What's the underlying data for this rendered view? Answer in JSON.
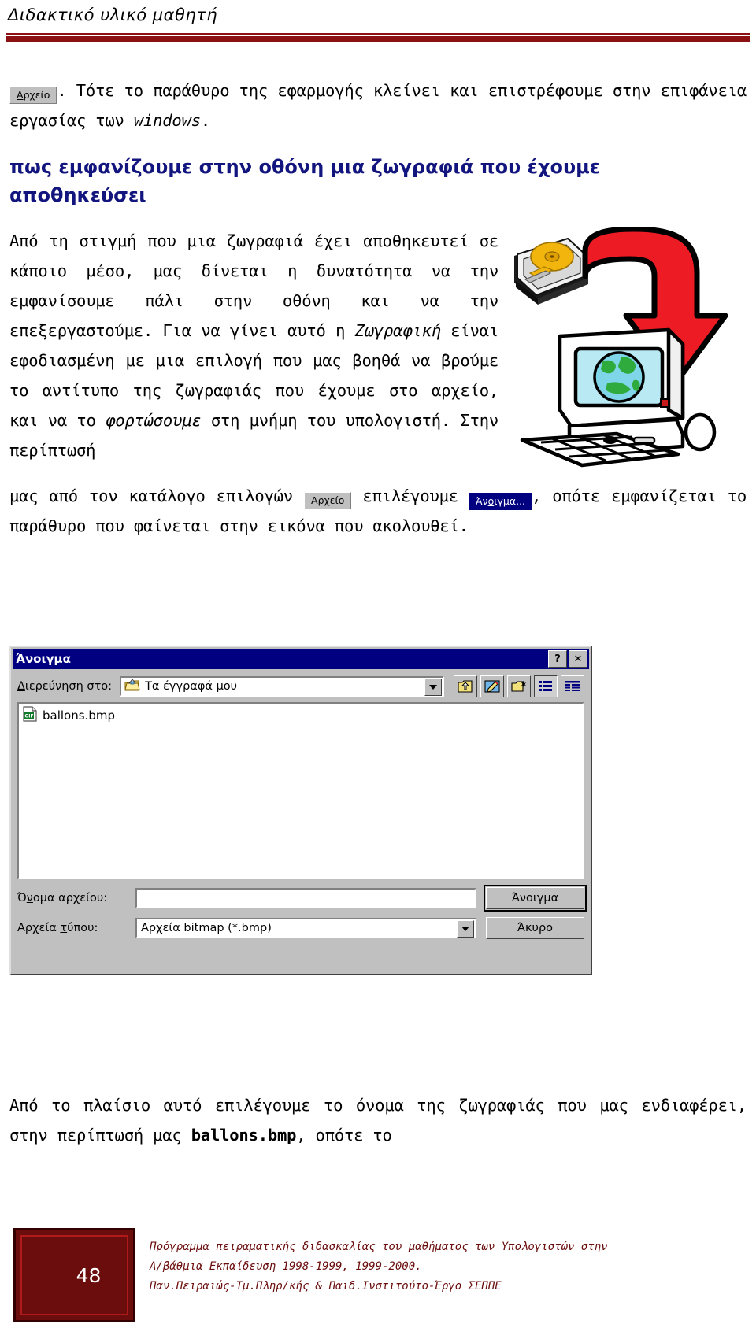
{
  "header": {
    "title": "Διδακτικό υλικό μαθητή",
    "rule_color": "#8b1113"
  },
  "content": {
    "para_intro_after_chip": ". Τότε το παράθυρο της εφαρμογής κλείνει και επιστρέφουμε στην επιφάνεια εργασίας των ",
    "para_intro_italic": "windows",
    "para_intro_end": ".",
    "heading_line1": "πως εμφανίζουμε στην οθόνη μια ζωγραφιά που έχουμε",
    "heading_line2": "αποθηκεύσει",
    "body_part1": "Από τη στιγμή που μια ζωγραφιά έχει αποθηκευτεί σε κάποιο μέσο, μας δίνεται η δυνατότητα να την εμφανίσουμε πάλι στην οθόνη και να την επεξεργαστούμε. Για να γίνει αυτό η ",
    "body_italic1": "Ζωγραφική",
    "body_part2": " είναι εφοδιασμένη με μια επιλογή που μας βοηθά να βρούμε το αντίτυπο της ζωγραφιάς που έχουμε στο αρχείο, και να το ",
    "body_italic2": "φορτώσουμε",
    "body_part3": " στη μνήμη του υπολογιστή. Στην περίπτωσή",
    "para_menu_part1": "μας από τον κατάλογο επιλογών ",
    "para_menu_part2": " επιλέγουμε ",
    "para_menu_part3": ", οπότε εμφανίζεται το παράθυρο που φαίνεται στην εικόνα που ακολουθεί.",
    "para_closing_part1": "Από το πλαίσιο αυτό επιλέγουμε το όνομα της ζωγραφιάς που μας ενδιαφέρει, στην περίπτωσή μας ",
    "para_closing_filename": "ballons.bmp",
    "para_closing_part2": ", οπότε το"
  },
  "inline_chips": {
    "file_menu_prefix": "Α",
    "file_menu_rest": "ρχείο",
    "open_menu_prefix": "Άν",
    "open_menu_mid": "ο",
    "open_menu_rest": "ιγμα..."
  },
  "clipart": {
    "harddisk": "hard-disk-drive-clipart",
    "arrow": "red-curved-down-arrow-clipart",
    "computer": "desktop-computer-with-globe-clipart"
  },
  "dialog": {
    "title": "Άνοιγμα",
    "help_button": "?",
    "close_button": "✕",
    "lookin_label_prefix": "Δ",
    "lookin_label_rest": "ιερεύνηση στο:",
    "lookin_value": "Τα έγγραφά μου",
    "toolbar_buttons": [
      {
        "name": "up-one-level-button",
        "icon": "folder-up-icon"
      },
      {
        "name": "favorites-button",
        "icon": "desktop-pencil-icon"
      },
      {
        "name": "new-folder-button",
        "icon": "new-folder-icon"
      },
      {
        "name": "list-view-button",
        "icon": "list-view-icon"
      },
      {
        "name": "details-view-button",
        "icon": "details-view-icon"
      }
    ],
    "files": [
      {
        "name": "ballons.bmp",
        "icon_label": "GIF"
      }
    ],
    "filename_label_prefix": "Ό",
    "filename_label_mid": "ν",
    "filename_label_rest": "ομα αρχείου:",
    "filename_value": "",
    "filetype_label_prefix": "Αρχεία ",
    "filetype_label_mid": "τ",
    "filetype_label_rest": "ύπου:",
    "filetype_value": "Αρχεία bitmap (*.bmp)",
    "open_button": "Άνοιγμα",
    "cancel_button": "Άκυρο"
  },
  "footer": {
    "page_number": "48",
    "line1": "Πρόγραμμα πειραματικής διδασκαλίας του μαθήματος των Υπολογιστών στην",
    "line2": "Α/βάθμια Εκπαίδευση 1998-1999, 1999-2000.",
    "line3": "Παν.Πειραιώς-Τμ.Πληρ/κής & Παιδ.Ινστιτούτο-Έργο ΣΕΠΠΕ",
    "color": "#6b0d0d"
  }
}
